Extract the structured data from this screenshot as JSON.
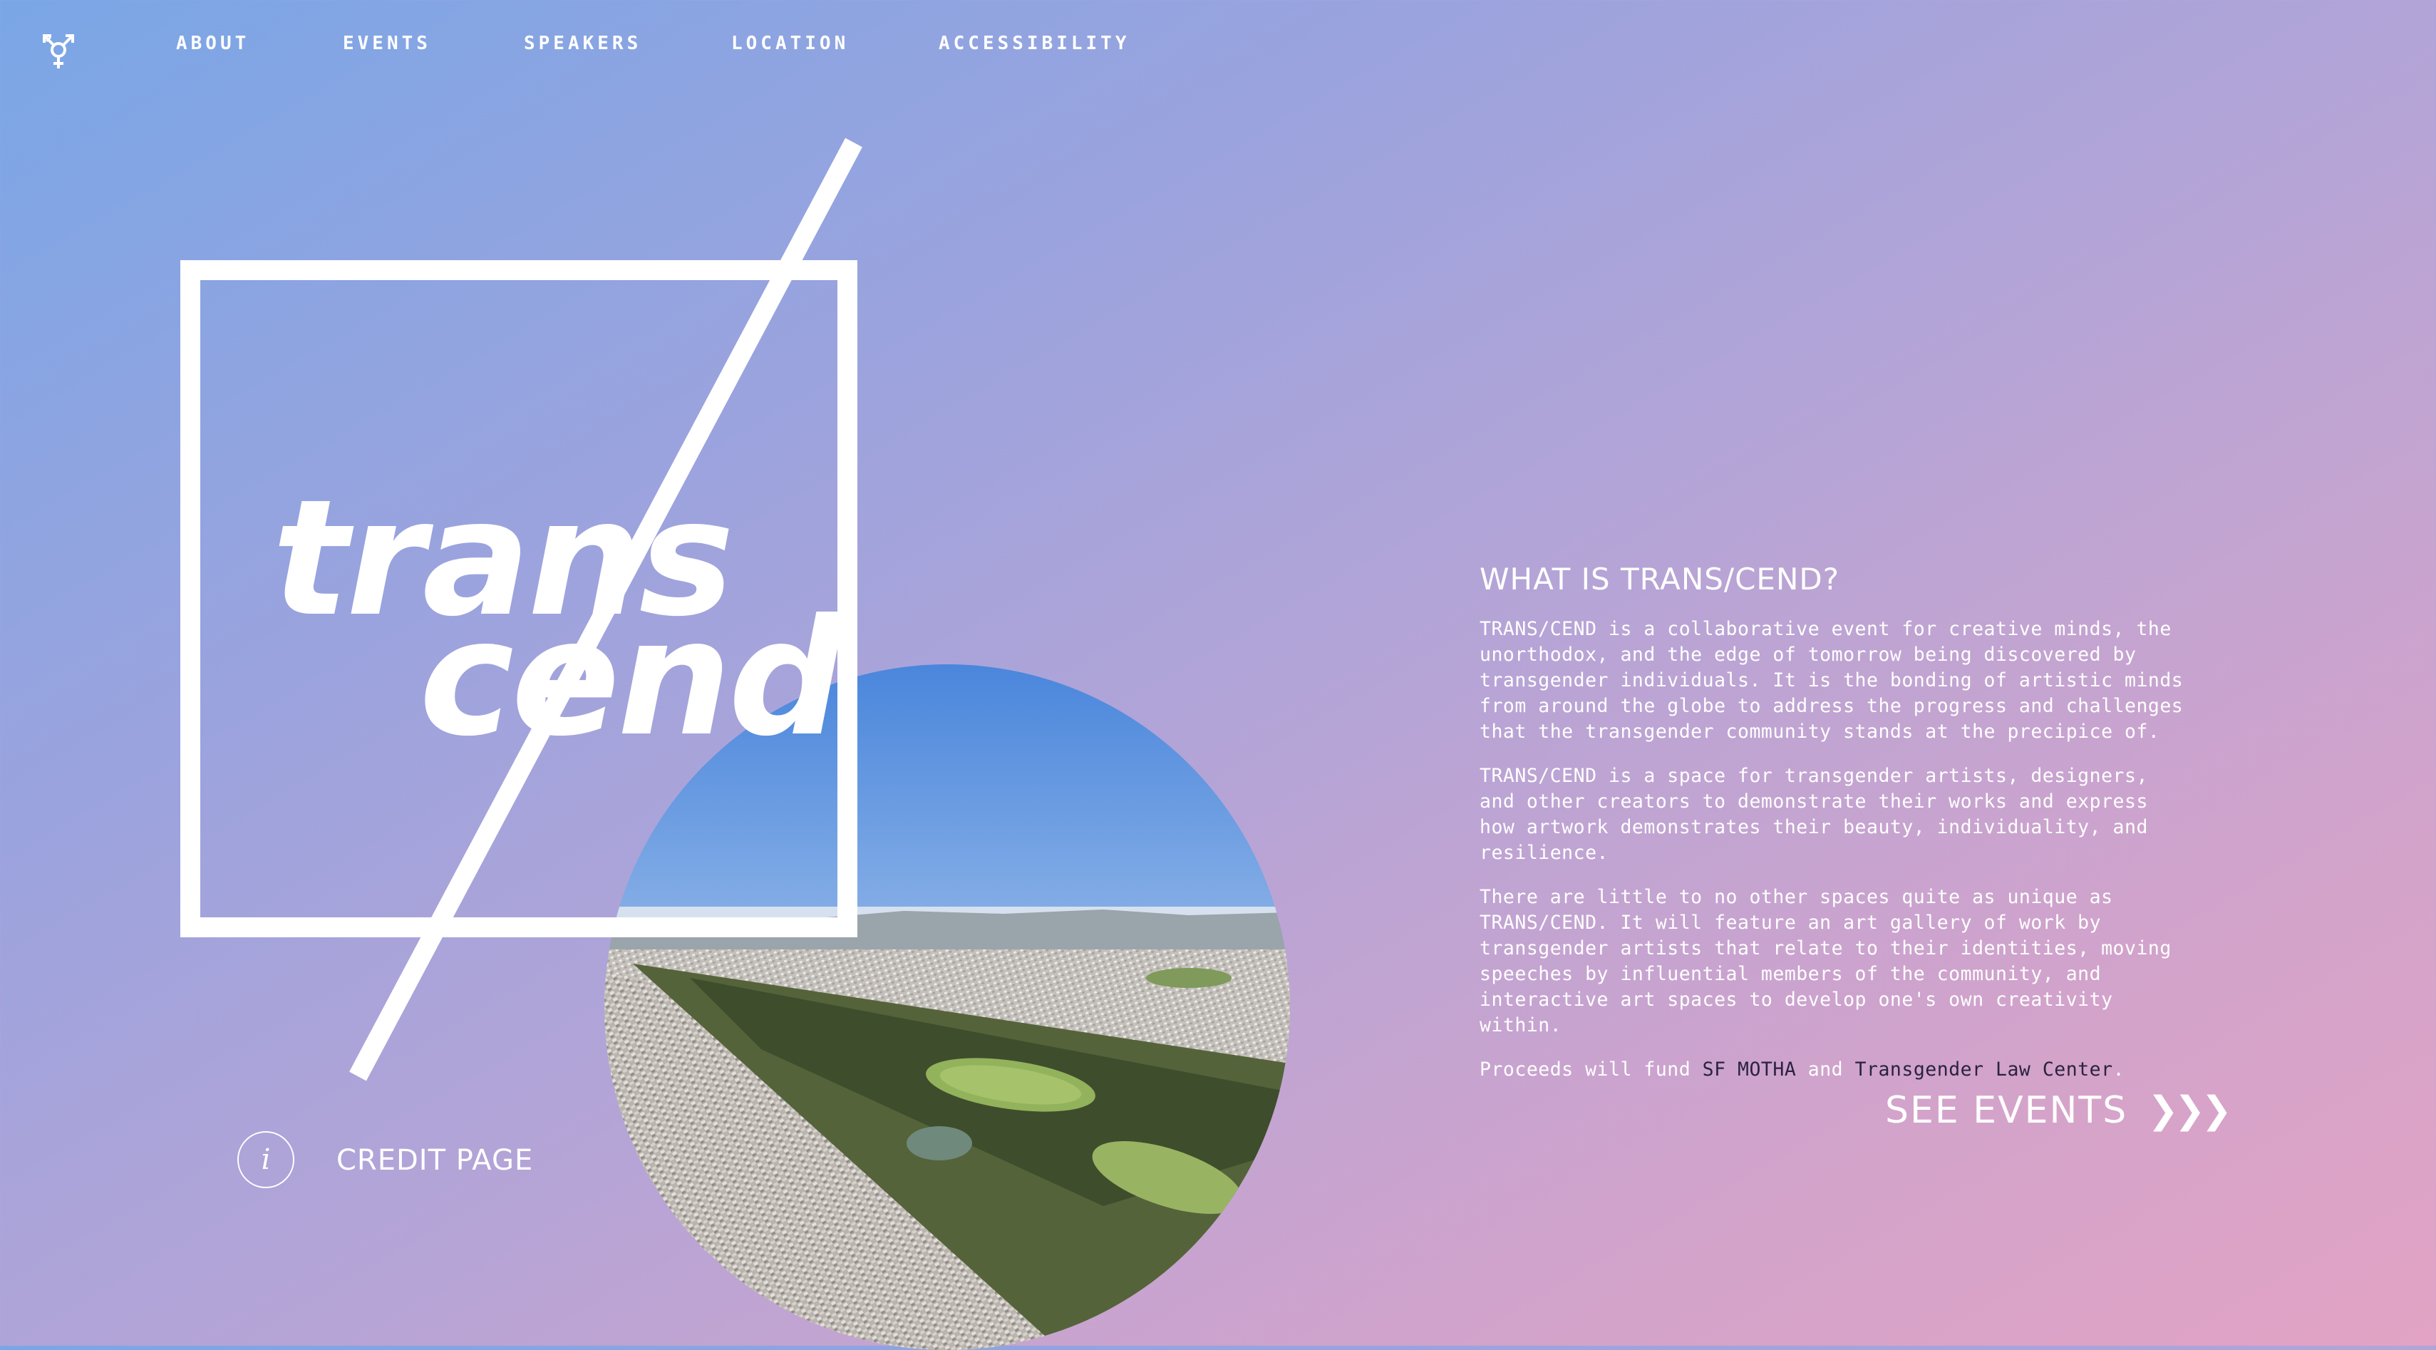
{
  "nav": {
    "logo_icon": "transgender-symbol-icon",
    "items": [
      {
        "label": "ABOUT"
      },
      {
        "label": "EVENTS"
      },
      {
        "label": "SPEAKERS"
      },
      {
        "label": "LOCATION"
      },
      {
        "label": "ACCESSIBILITY"
      }
    ]
  },
  "hero": {
    "wordmark_top": "trans",
    "wordmark_bottom": "cend",
    "photo_alt": "Aerial view of San Francisco and Golden Gate Park"
  },
  "credit": {
    "icon": "info-icon",
    "icon_glyph": "i",
    "label": "CREDIT PAGE"
  },
  "about": {
    "heading": "WHAT IS TRANS/CEND?",
    "p1": "TRANS/CEND is a collaborative event for creative minds, the unorthodox, and the edge of tomorrow being discovered by transgender individuals. It is the bonding of artistic minds from around the globe to address the progress and challenges that the transgender community stands at the precipice of.",
    "p2": "TRANS/CEND is a space for transgender artists, designers, and other creators to demonstrate their works and express how artwork demonstrates their beauty, individuality, and resilience.",
    "p3": "There are little to no other spaces quite as unique as TRANS/CEND. It will feature an art gallery of work by transgender artists that relate to their identities, moving speeches by influential members of the community, and interactive art spaces to develop one's own creativity within.",
    "p4_prefix": "Proceeds will fund ",
    "link1": "SF MOTHA",
    "p4_and": " and ",
    "link2": "Transgender Law Center",
    "p4_suffix": "."
  },
  "cta": {
    "label": "SEE EVENTS",
    "chevrons": "❯❯❯"
  },
  "colors": {
    "gradient_start": "#7aa6e6",
    "gradient_end": "#e2a3c4",
    "text": "#ffffff",
    "link": "#2a2340"
  }
}
